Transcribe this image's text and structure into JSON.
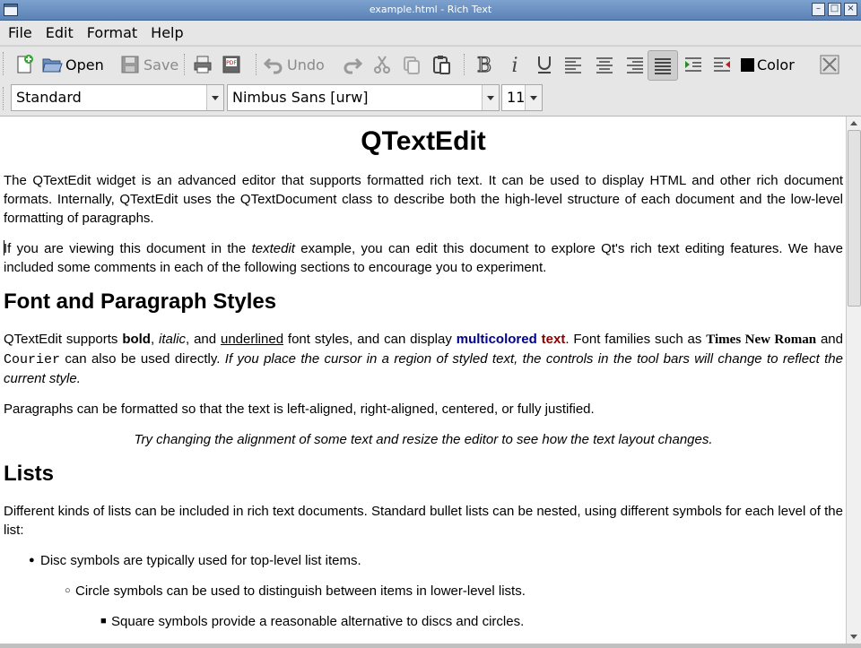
{
  "window": {
    "title": "example.html - Rich Text"
  },
  "menu": {
    "file": "File",
    "edit": "Edit",
    "format": "Format",
    "help": "Help"
  },
  "toolbar": {
    "open": "Open",
    "save": "Save",
    "undo": "Undo",
    "color": "Color"
  },
  "format_bar": {
    "style": "Standard",
    "font": "Nimbus Sans [urw]",
    "size": "11"
  },
  "document": {
    "title": "QTextEdit",
    "p1": "The QTextEdit widget is an advanced editor that supports formatted rich text. It can be used to display HTML and other rich document formats. Internally, QTextEdit uses the QTextDocument class to describe both the high-level structure of each document and the low-level formatting of paragraphs.",
    "p2_a": "If you are viewing this document in the ",
    "p2_b": "textedit",
    "p2_c": " example, you can edit this document to explore Qt's rich text editing features. We have included some comments in each of the following sections to encourage you to experiment.",
    "h_font": "Font and Paragraph Styles",
    "p3": {
      "a": "QTextEdit supports ",
      "bold": "bold",
      "b": ", ",
      "italic": "italic",
      "c": ", and ",
      "underlined": "underlined",
      "d": " font styles, and can display ",
      "multicolored": "multicolored",
      "e": " ",
      "text": "text",
      "f": ". Font families such as ",
      "times": "Times New Roman",
      "g": " and ",
      "courier": "Courier",
      "h": " can also be used directly. ",
      "hint": "If you place the cursor in a region of styled text, the controls in the tool bars will change to reflect the current style."
    },
    "p4": "Paragraphs can be formatted so that the text is left-aligned, right-aligned, centered, or fully justified.",
    "p5": "Try changing the alignment of some text and resize the editor to see how the text layout changes.",
    "h_lists": "Lists",
    "p6": "Different kinds of lists can be included in rich text documents. Standard bullet lists can be nested, using different symbols for each level of the list:",
    "list": [
      {
        "bullet": "●",
        "text": "Disc symbols are typically used for top-level list items."
      },
      {
        "bullet": "○",
        "text": "Circle symbols can be used to distinguish between items in lower-level lists."
      },
      {
        "bullet": "■",
        "text": "Square symbols provide a reasonable alternative to discs and circles."
      }
    ]
  }
}
